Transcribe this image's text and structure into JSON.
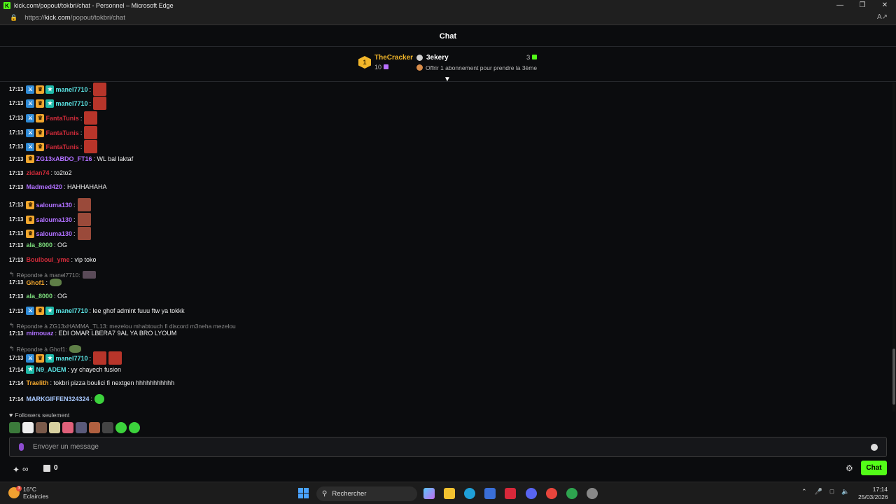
{
  "window": {
    "title": "kick.com/popout/tokbri/chat - Personnel – Microsoft Edge",
    "favicon_letter": "K",
    "url_prefix": "https://",
    "url_host": "kick.com",
    "url_path": "/popout/tokbri/chat"
  },
  "header": {
    "title": "Chat"
  },
  "leaderboard": {
    "first": {
      "rank": "1",
      "name": "TheCracker",
      "count": "10"
    },
    "second": {
      "name": "3ekery",
      "count": "3"
    },
    "offer": "Offrir 1 abonnement pour prendre la 3ème"
  },
  "messages": [
    {
      "ts": "17:13",
      "user": "manel7710",
      "color": "#5ce6e6",
      "badges": [
        "mod",
        "crown",
        "sub"
      ],
      "text": ":",
      "emotes": [
        "red"
      ]
    },
    {
      "ts": "17:13",
      "user": "manel7710",
      "color": "#5ce6e6",
      "badges": [
        "mod",
        "crown",
        "sub"
      ],
      "text": ":",
      "emotes": [
        "red"
      ]
    },
    {
      "ts": "17:13",
      "user": "FantaTunis",
      "color": "#d12b3a",
      "badges": [
        "mod",
        "crown"
      ],
      "text": ":",
      "emotes": [
        "red"
      ]
    },
    {
      "ts": "17:13",
      "user": "FantaTunis",
      "color": "#d12b3a",
      "badges": [
        "mod",
        "crown"
      ],
      "text": ":",
      "emotes": [
        "red"
      ]
    },
    {
      "ts": "17:13",
      "user": "FantaTunis",
      "color": "#d12b3a",
      "badges": [
        "mod",
        "crown"
      ],
      "text": ":",
      "emotes": [
        "red"
      ]
    },
    {
      "ts": "17:13",
      "user": "ZG13xABDO_FT16",
      "color": "#b070ff",
      "badges": [
        "crown"
      ],
      "text": ": WL bal laktaf",
      "emotes": []
    },
    {
      "ts": "17:13",
      "user": "zidan74",
      "color": "#d12b3a",
      "badges": [],
      "text": ": to2to2",
      "emotes": []
    },
    {
      "ts": "17:13",
      "user": "Madmed420",
      "color": "#b070ff",
      "badges": [],
      "text": ": HAHHAHAHA",
      "emotes": []
    },
    {
      "ts": "17:13",
      "user": "salouma130",
      "color": "#b070ff",
      "badges": [
        "crown"
      ],
      "text": ":",
      "emotes": [
        "plain"
      ]
    },
    {
      "ts": "17:13",
      "user": "salouma130",
      "color": "#b070ff",
      "badges": [
        "crown"
      ],
      "text": ":",
      "emotes": [
        "plain"
      ]
    },
    {
      "ts": "17:13",
      "user": "salouma130",
      "color": "#b070ff",
      "badges": [
        "crown"
      ],
      "text": ":",
      "emotes": [
        "plain"
      ]
    },
    {
      "ts": "17:13",
      "user": "ala_8000",
      "color": "#7ee07e",
      "badges": [],
      "text": ": OG",
      "emotes": []
    },
    {
      "ts": "17:13",
      "user": "Boulboul_yme",
      "color": "#d12b3a",
      "badges": [],
      "text": ": vip toko",
      "emotes": []
    },
    {
      "reply": "Répondre à manel7710:",
      "reply_emote": true
    },
    {
      "ts": "17:13",
      "user": "Ghof1",
      "color": "#f2a72e",
      "badges": [],
      "text": ":",
      "emotes": [
        "frog"
      ]
    },
    {
      "ts": "17:13",
      "user": "ala_8000",
      "color": "#7ee07e",
      "badges": [],
      "text": ": OG",
      "emotes": []
    },
    {
      "ts": "17:13",
      "user": "manel7710",
      "color": "#5ce6e6",
      "badges": [
        "mod",
        "crown",
        "sub"
      ],
      "text": ": lee ghof admint fuuu ftw ya tokkk",
      "emotes": []
    },
    {
      "reply": "Répondre à ZG13xHAMMA_TL13: mezelou mhabtouch fi discord m3neha mezelou",
      "reply_emote": false
    },
    {
      "ts": "17:13",
      "user": "mimouaz",
      "color": "#b070ff",
      "badges": [],
      "text": ": EDI OMAR LBERA7 9AL YA BRO LYOUM",
      "emotes": []
    },
    {
      "reply": "Répondre à Ghof1:",
      "reply_emote": true,
      "reply_frog": true
    },
    {
      "ts": "17:13",
      "user": "manel7710",
      "color": "#5ce6e6",
      "badges": [
        "mod",
        "crown",
        "sub"
      ],
      "text": ":",
      "emotes": [
        "red",
        "red"
      ]
    },
    {
      "ts": "17:14",
      "user": "N9_ADEM",
      "color": "#5ce6e6",
      "badges": [
        "sub"
      ],
      "text": ": yy chayech fusion",
      "emotes": []
    },
    {
      "ts": "17:14",
      "user": "Traelith",
      "color": "#f2a72e",
      "badges": [],
      "text": ": tokbri pizza boulici fi nextgen hhhhhhhhhhh",
      "emotes": []
    },
    {
      "ts": "17:14",
      "user": "MARKGIFFEN324324",
      "color": "#a8c8ff",
      "badges": [],
      "text": ":",
      "emotes": [
        "green"
      ]
    }
  ],
  "footer": {
    "followers_only": "Followers seulement",
    "input_placeholder": "Envoyer un message",
    "points": "0",
    "chat_button": "Chat"
  },
  "taskbar": {
    "temperature": "16°C",
    "condition": "Eclaircies",
    "search_label": "Rechercher",
    "time": "17:14",
    "date": "25/03/2026",
    "weather_badge": "3"
  },
  "colors": {
    "kick_green": "#53fc18",
    "background": "#0b0c0e"
  }
}
